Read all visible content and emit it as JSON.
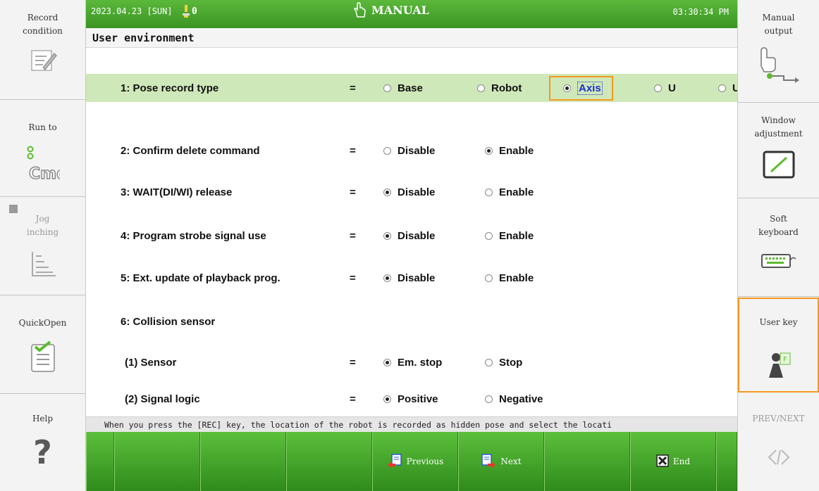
{
  "colors": {
    "accent_green": "#3a9422",
    "highlight_row": "#cfe8b9",
    "focus_orange": "#f39a1e",
    "focus_text": "#1a2fd0"
  },
  "status": {
    "date": "2023.04.23 [SUN]",
    "count": "0",
    "mode": "MANUAL",
    "time": "03:30:34 PM"
  },
  "title": "User environment",
  "left_panel": [
    {
      "label": "Record\ncondition",
      "icon": "record-condition-icon"
    },
    {
      "label": "Run to",
      "icon": "cmd-icon"
    },
    {
      "label": "Jog\ninching",
      "icon": "jog-inching-icon"
    },
    {
      "label": "QuickOpen",
      "icon": "quick-open-icon"
    },
    {
      "label": "Help",
      "icon": "help-icon"
    }
  ],
  "right_panel": [
    {
      "label": "Manual\noutput",
      "icon": "manual-output-icon"
    },
    {
      "label": "Window\nadjustment",
      "icon": "window-adjustment-icon"
    },
    {
      "label": "Soft\nkeyboard",
      "icon": "soft-keyboard-icon"
    },
    {
      "label": "User key",
      "icon": "user-key-icon"
    },
    {
      "label": "PREV/NEXT",
      "icon": "prev-next-icon"
    }
  ],
  "settings": [
    {
      "label": "1: Pose record type",
      "eq": "=",
      "options": [
        "Base",
        "Robot",
        "Axis",
        "U",
        "U"
      ],
      "selected": 2
    },
    {
      "label": "2: Confirm delete command",
      "eq": "=",
      "options": [
        "Disable",
        "Enable"
      ],
      "selected": 1
    },
    {
      "label": "3: WAIT(DI/WI) release",
      "eq": "=",
      "options": [
        "Disable",
        "Enable"
      ],
      "selected": 0
    },
    {
      "label": "4: Program strobe signal use",
      "eq": "=",
      "options": [
        "Disable",
        "Enable"
      ],
      "selected": 0
    },
    {
      "label": "5: Ext. update of playback prog.",
      "eq": "=",
      "options": [
        "Disable",
        "Enable"
      ],
      "selected": 0
    },
    {
      "label": "6: Collision sensor"
    },
    {
      "label": "(1) Sensor",
      "eq": "=",
      "options": [
        "Em. stop",
        "Stop"
      ],
      "selected": 0
    },
    {
      "label": "(2) Signal logic",
      "eq": "=",
      "options": [
        "Positive",
        "Negative"
      ],
      "selected": 0
    }
  ],
  "hint": "When you press the [REC] key, the location of the robot is recorded as hidden pose and select the locati",
  "fkeys": {
    "previous": "Previous",
    "next": "Next",
    "end": "End"
  }
}
